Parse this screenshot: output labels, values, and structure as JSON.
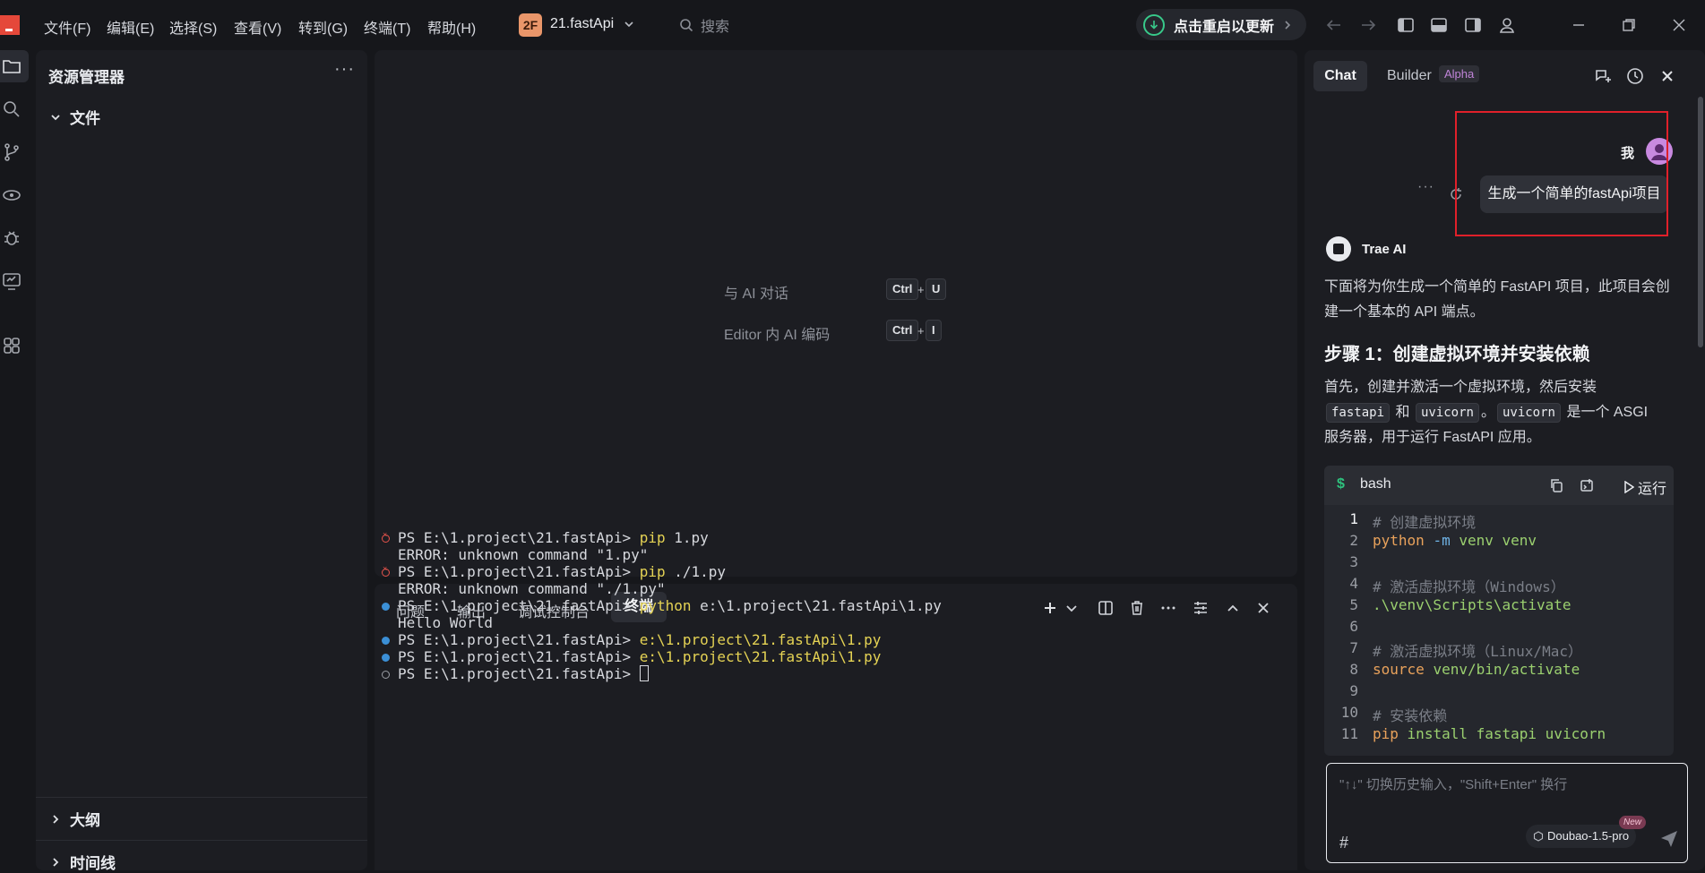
{
  "titlebar": {
    "menus": [
      "文件(F)",
      "编辑(E)",
      "选择(S)",
      "查看(V)",
      "转到(G)",
      "终端(T)",
      "帮助(H)"
    ],
    "project_badge": "2F",
    "project_name": "21.fastApi",
    "search_placeholder": "搜索",
    "update_label": "点击重启以更新"
  },
  "explorer": {
    "title": "资源管理器",
    "more": "···",
    "files_section": "文件",
    "outline_section": "大纲",
    "timeline_section": "时间线"
  },
  "editor": {
    "hints": [
      {
        "label": "与 AI 对话",
        "keys": [
          "Ctrl",
          "U"
        ]
      },
      {
        "label": "Editor 内 AI 编码",
        "keys": [
          "Ctrl",
          "I"
        ]
      }
    ],
    "plus": "+"
  },
  "panel": {
    "tabs": [
      "问题",
      "输出",
      "调试控制台",
      "终端"
    ],
    "active_tab": "终端",
    "lines": [
      {
        "status": "error",
        "prompt": "PS E:\\1.project\\21.fastApi> ",
        "cmd": "pip",
        "rest": " 1.py"
      },
      {
        "status": "none",
        "text": "ERROR: unknown command \"1.py\""
      },
      {
        "status": "error",
        "prompt": "PS E:\\1.project\\21.fastApi> ",
        "cmd": "pip",
        "rest": " ./1.py"
      },
      {
        "status": "none",
        "text": "ERROR: unknown command \"./1.py\""
      },
      {
        "status": "ok",
        "prompt": "PS E:\\1.project\\21.fastApi> ",
        "cmd": "python",
        "rest": " e:\\1.project\\21.fastApi\\1.py"
      },
      {
        "status": "none",
        "text": "Hello World"
      },
      {
        "status": "ok",
        "prompt": "PS E:\\1.project\\21.fastApi> ",
        "cmd": "e:\\1.project\\21.fastApi\\1.py",
        "rest": ""
      },
      {
        "status": "ok",
        "prompt": "PS E:\\1.project\\21.fastApi> ",
        "cmd": "e:\\1.project\\21.fastApi\\1.py",
        "rest": ""
      },
      {
        "status": "idle",
        "prompt": "PS E:\\1.project\\21.fastApi> ",
        "cmd": "",
        "rest": ""
      }
    ]
  },
  "chat": {
    "tab_chat": "Chat",
    "tab_builder": "Builder",
    "alpha": "Alpha",
    "user_name": "我",
    "user_message": "生成一个简单的fastApi项目",
    "more": "···",
    "ai_name": "Trae AI",
    "ai_intro": "下面将为你生成一个简单的 FastAPI 项目，此项目会创建一个基本的 API 端点。",
    "step_title": "步骤 1：创建虚拟环境并安装依赖",
    "step_text_1": "首先，创建并激活一个虚拟环境，然后安装",
    "code_fastapi": "fastapi",
    "and": "和",
    "code_uvicorn": "uvicorn",
    "sep": "。",
    "code_uvicorn2": "uvicorn",
    "step_text_2": "是一个 ASGI",
    "step_text_3": "服务器，用于运行 FastAPI 应用。",
    "code_dollar": "$",
    "code_lang": "bash",
    "code_run": "运行",
    "code_lines": [
      {
        "n": "1",
        "parts": [
          [
            "c-comment",
            "# 创建虚拟环境"
          ]
        ]
      },
      {
        "n": "2",
        "parts": [
          [
            "c-cmd",
            "python"
          ],
          [
            "",
            " "
          ],
          [
            "c-flag",
            "-m"
          ],
          [
            "",
            " "
          ],
          [
            "c-arg",
            "venv venv"
          ]
        ]
      },
      {
        "n": "3",
        "parts": []
      },
      {
        "n": "4",
        "parts": [
          [
            "c-comment",
            "# 激活虚拟环境（Windows）"
          ]
        ]
      },
      {
        "n": "5",
        "parts": [
          [
            "c-arg",
            ".\\venv\\Scripts\\activate"
          ]
        ]
      },
      {
        "n": "6",
        "parts": []
      },
      {
        "n": "7",
        "parts": [
          [
            "c-comment",
            "# 激活虚拟环境（Linux/Mac）"
          ]
        ]
      },
      {
        "n": "8",
        "parts": [
          [
            "c-cmd",
            "source"
          ],
          [
            "",
            " "
          ],
          [
            "c-arg",
            "venv/bin/activate"
          ]
        ]
      },
      {
        "n": "9",
        "parts": []
      },
      {
        "n": "10",
        "parts": [
          [
            "c-comment",
            "# 安装依赖"
          ]
        ]
      },
      {
        "n": "11",
        "parts": [
          [
            "c-cmd",
            "pip"
          ],
          [
            "",
            " "
          ],
          [
            "c-arg",
            "install fastapi uvicorn"
          ]
        ]
      }
    ],
    "input_placeholder": "\"↑↓\" 切换历史输入，\"Shift+Enter\" 换行",
    "hash": "#",
    "model": "Doubao-1.5-pro",
    "new_badge": "New"
  }
}
